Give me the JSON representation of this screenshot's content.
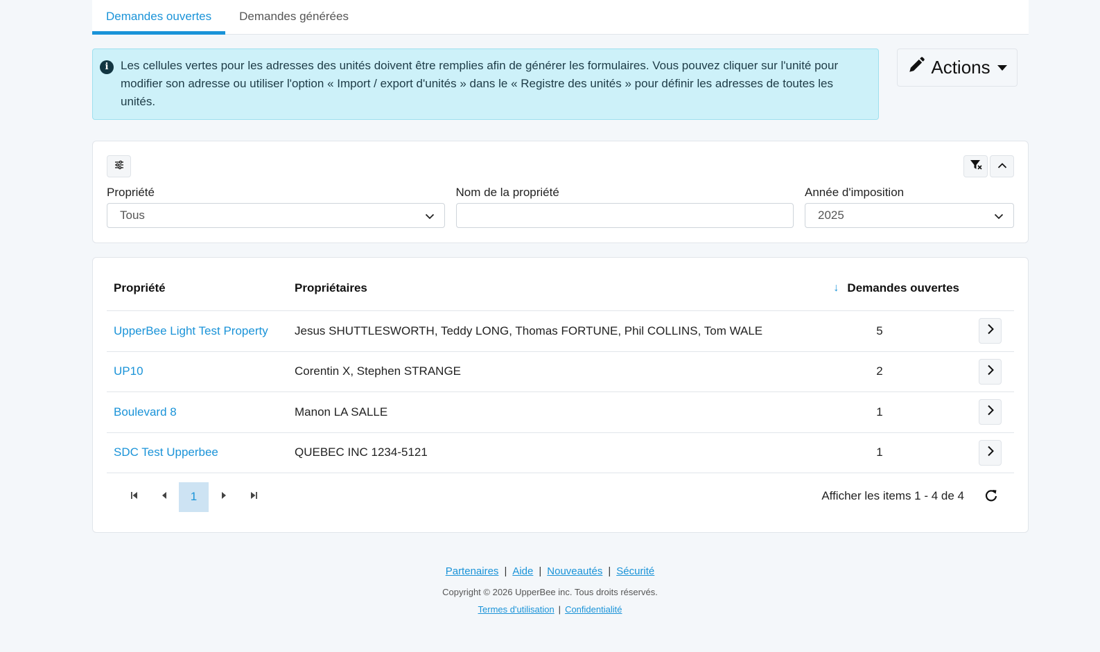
{
  "tabs": [
    {
      "label": "Demandes ouvertes",
      "active": true
    },
    {
      "label": "Demandes générées",
      "active": false
    }
  ],
  "alert": {
    "icon": "info-icon",
    "text": "Les cellules vertes pour les adresses des unités doivent être remplies afin de générer les formulaires. Vous pouvez cliquer sur l'unité pour modifier son adresse ou utiliser l'option « Import / export d'unités » dans le « Registre des unités » pour définir les adresses de toutes les unités."
  },
  "actions": {
    "label": "Actions",
    "icon": "pencil-icon"
  },
  "filters": {
    "property": {
      "label": "Propriété",
      "value": "Tous"
    },
    "property_name": {
      "label": "Nom de la propriété",
      "value": ""
    },
    "tax_year": {
      "label": "Année d'imposition",
      "value": "2025"
    }
  },
  "table": {
    "headers": {
      "property": "Propriété",
      "owners": "Propriétaires",
      "open_requests": "Demandes ouvertes"
    },
    "sort": {
      "column": "open_requests",
      "direction": "desc"
    },
    "rows": [
      {
        "property": "UpperBee Light Test Property",
        "owners": "Jesus SHUTTLESWORTH, Teddy LONG, Thomas FORTUNE, Phil COLLINS, Tom WALE",
        "count": "5"
      },
      {
        "property": "UP10",
        "owners": "Corentin X, Stephen STRANGE",
        "count": "2"
      },
      {
        "property": "Boulevard 8",
        "owners": "Manon LA SALLE",
        "count": "1"
      },
      {
        "property": "SDC Test Upperbee",
        "owners": "QUEBEC INC 1234-5121",
        "count": "1"
      }
    ]
  },
  "pager": {
    "current_page": "1",
    "info": "Afficher les items 1 - 4 de 4"
  },
  "footer": {
    "links": [
      "Partenaires",
      "Aide",
      "Nouveautés",
      "Sécurité"
    ],
    "copyright": "Copyright © 2026 UpperBee inc. Tous droits réservés.",
    "legal": [
      "Termes d'utilisation",
      "Confidentialité"
    ]
  },
  "colors": {
    "accent": "#1a93d8",
    "alert_bg": "#cdf1f9",
    "page_bg": "#f4f7fa"
  }
}
